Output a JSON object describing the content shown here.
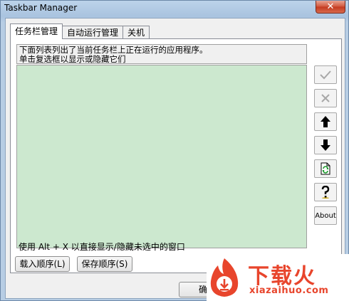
{
  "window": {
    "title": "Taskbar Manager",
    "close_glyph": "✕"
  },
  "tabs": [
    {
      "label": "任务栏管理",
      "active": true
    },
    {
      "label": "自动运行管理",
      "active": false
    },
    {
      "label": "关机",
      "active": false
    }
  ],
  "description": {
    "line1": "下面列表列出了当前任务栏上正在运行的应用程序。",
    "line2": "单击复选框以显示或隐藏它们"
  },
  "side_buttons": {
    "check_icon": "check-icon",
    "cross_icon": "cross-icon",
    "up_icon": "arrow-up-icon",
    "down_icon": "arrow-down-icon",
    "refresh_icon": "refresh-icon",
    "help_icon": "help-icon",
    "about_label": "About"
  },
  "hint": "使用 Alt + X 以直接显示/隐藏未选中的窗口",
  "buttons": {
    "load_order": "载入顺序(L)",
    "save_order": "保存顺序(S)",
    "ok": "确定"
  },
  "watermark": {
    "title": "下载火",
    "subtitle": "xiazaihuo.com"
  },
  "colors": {
    "list_bg": "#cce8cf",
    "brand": "#e8452c",
    "close": "#c3391f"
  }
}
